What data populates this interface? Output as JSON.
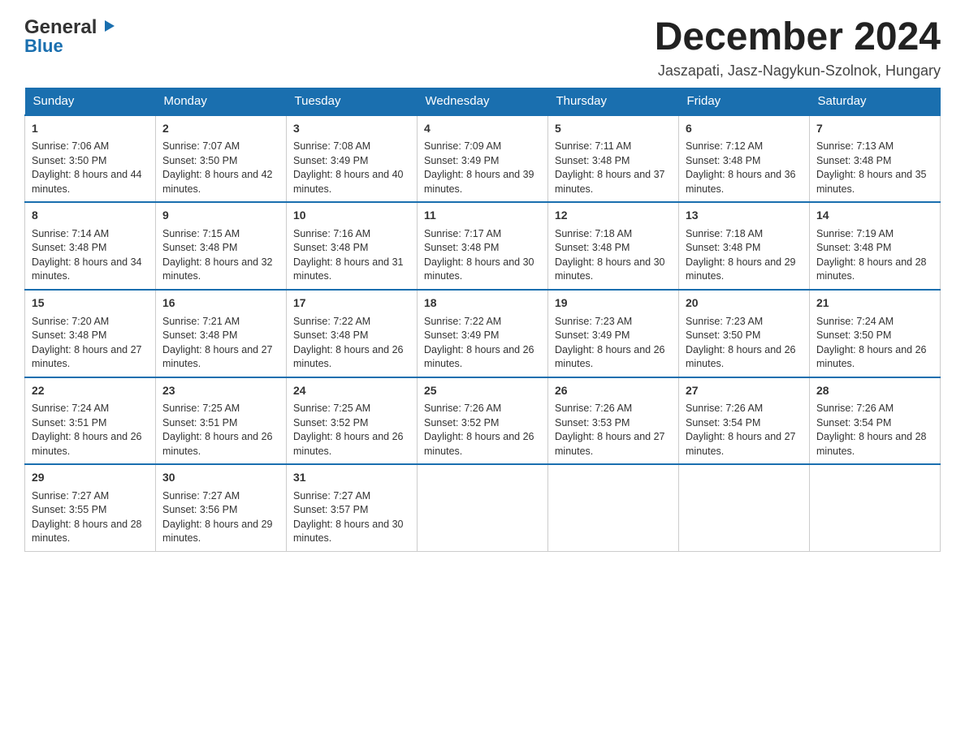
{
  "header": {
    "logo_general": "General",
    "logo_blue": "Blue",
    "month_title": "December 2024",
    "location": "Jaszapati, Jasz-Nagykun-Szolnok, Hungary"
  },
  "days_of_week": [
    "Sunday",
    "Monday",
    "Tuesday",
    "Wednesday",
    "Thursday",
    "Friday",
    "Saturday"
  ],
  "weeks": [
    [
      {
        "day": "1",
        "sunrise": "Sunrise: 7:06 AM",
        "sunset": "Sunset: 3:50 PM",
        "daylight": "Daylight: 8 hours and 44 minutes."
      },
      {
        "day": "2",
        "sunrise": "Sunrise: 7:07 AM",
        "sunset": "Sunset: 3:50 PM",
        "daylight": "Daylight: 8 hours and 42 minutes."
      },
      {
        "day": "3",
        "sunrise": "Sunrise: 7:08 AM",
        "sunset": "Sunset: 3:49 PM",
        "daylight": "Daylight: 8 hours and 40 minutes."
      },
      {
        "day": "4",
        "sunrise": "Sunrise: 7:09 AM",
        "sunset": "Sunset: 3:49 PM",
        "daylight": "Daylight: 8 hours and 39 minutes."
      },
      {
        "day": "5",
        "sunrise": "Sunrise: 7:11 AM",
        "sunset": "Sunset: 3:48 PM",
        "daylight": "Daylight: 8 hours and 37 minutes."
      },
      {
        "day": "6",
        "sunrise": "Sunrise: 7:12 AM",
        "sunset": "Sunset: 3:48 PM",
        "daylight": "Daylight: 8 hours and 36 minutes."
      },
      {
        "day": "7",
        "sunrise": "Sunrise: 7:13 AM",
        "sunset": "Sunset: 3:48 PM",
        "daylight": "Daylight: 8 hours and 35 minutes."
      }
    ],
    [
      {
        "day": "8",
        "sunrise": "Sunrise: 7:14 AM",
        "sunset": "Sunset: 3:48 PM",
        "daylight": "Daylight: 8 hours and 34 minutes."
      },
      {
        "day": "9",
        "sunrise": "Sunrise: 7:15 AM",
        "sunset": "Sunset: 3:48 PM",
        "daylight": "Daylight: 8 hours and 32 minutes."
      },
      {
        "day": "10",
        "sunrise": "Sunrise: 7:16 AM",
        "sunset": "Sunset: 3:48 PM",
        "daylight": "Daylight: 8 hours and 31 minutes."
      },
      {
        "day": "11",
        "sunrise": "Sunrise: 7:17 AM",
        "sunset": "Sunset: 3:48 PM",
        "daylight": "Daylight: 8 hours and 30 minutes."
      },
      {
        "day": "12",
        "sunrise": "Sunrise: 7:18 AM",
        "sunset": "Sunset: 3:48 PM",
        "daylight": "Daylight: 8 hours and 30 minutes."
      },
      {
        "day": "13",
        "sunrise": "Sunrise: 7:18 AM",
        "sunset": "Sunset: 3:48 PM",
        "daylight": "Daylight: 8 hours and 29 minutes."
      },
      {
        "day": "14",
        "sunrise": "Sunrise: 7:19 AM",
        "sunset": "Sunset: 3:48 PM",
        "daylight": "Daylight: 8 hours and 28 minutes."
      }
    ],
    [
      {
        "day": "15",
        "sunrise": "Sunrise: 7:20 AM",
        "sunset": "Sunset: 3:48 PM",
        "daylight": "Daylight: 8 hours and 27 minutes."
      },
      {
        "day": "16",
        "sunrise": "Sunrise: 7:21 AM",
        "sunset": "Sunset: 3:48 PM",
        "daylight": "Daylight: 8 hours and 27 minutes."
      },
      {
        "day": "17",
        "sunrise": "Sunrise: 7:22 AM",
        "sunset": "Sunset: 3:48 PM",
        "daylight": "Daylight: 8 hours and 26 minutes."
      },
      {
        "day": "18",
        "sunrise": "Sunrise: 7:22 AM",
        "sunset": "Sunset: 3:49 PM",
        "daylight": "Daylight: 8 hours and 26 minutes."
      },
      {
        "day": "19",
        "sunrise": "Sunrise: 7:23 AM",
        "sunset": "Sunset: 3:49 PM",
        "daylight": "Daylight: 8 hours and 26 minutes."
      },
      {
        "day": "20",
        "sunrise": "Sunrise: 7:23 AM",
        "sunset": "Sunset: 3:50 PM",
        "daylight": "Daylight: 8 hours and 26 minutes."
      },
      {
        "day": "21",
        "sunrise": "Sunrise: 7:24 AM",
        "sunset": "Sunset: 3:50 PM",
        "daylight": "Daylight: 8 hours and 26 minutes."
      }
    ],
    [
      {
        "day": "22",
        "sunrise": "Sunrise: 7:24 AM",
        "sunset": "Sunset: 3:51 PM",
        "daylight": "Daylight: 8 hours and 26 minutes."
      },
      {
        "day": "23",
        "sunrise": "Sunrise: 7:25 AM",
        "sunset": "Sunset: 3:51 PM",
        "daylight": "Daylight: 8 hours and 26 minutes."
      },
      {
        "day": "24",
        "sunrise": "Sunrise: 7:25 AM",
        "sunset": "Sunset: 3:52 PM",
        "daylight": "Daylight: 8 hours and 26 minutes."
      },
      {
        "day": "25",
        "sunrise": "Sunrise: 7:26 AM",
        "sunset": "Sunset: 3:52 PM",
        "daylight": "Daylight: 8 hours and 26 minutes."
      },
      {
        "day": "26",
        "sunrise": "Sunrise: 7:26 AM",
        "sunset": "Sunset: 3:53 PM",
        "daylight": "Daylight: 8 hours and 27 minutes."
      },
      {
        "day": "27",
        "sunrise": "Sunrise: 7:26 AM",
        "sunset": "Sunset: 3:54 PM",
        "daylight": "Daylight: 8 hours and 27 minutes."
      },
      {
        "day": "28",
        "sunrise": "Sunrise: 7:26 AM",
        "sunset": "Sunset: 3:54 PM",
        "daylight": "Daylight: 8 hours and 28 minutes."
      }
    ],
    [
      {
        "day": "29",
        "sunrise": "Sunrise: 7:27 AM",
        "sunset": "Sunset: 3:55 PM",
        "daylight": "Daylight: 8 hours and 28 minutes."
      },
      {
        "day": "30",
        "sunrise": "Sunrise: 7:27 AM",
        "sunset": "Sunset: 3:56 PM",
        "daylight": "Daylight: 8 hours and 29 minutes."
      },
      {
        "day": "31",
        "sunrise": "Sunrise: 7:27 AM",
        "sunset": "Sunset: 3:57 PM",
        "daylight": "Daylight: 8 hours and 30 minutes."
      },
      null,
      null,
      null,
      null
    ]
  ]
}
